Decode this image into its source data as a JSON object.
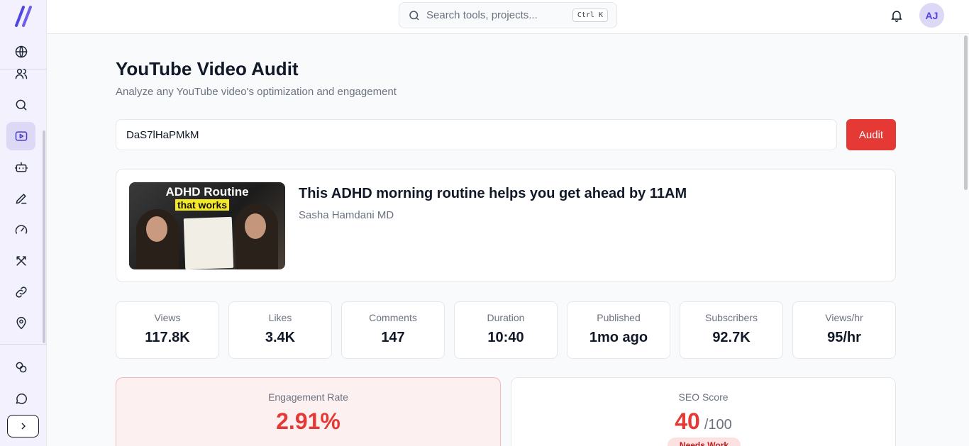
{
  "search": {
    "placeholder": "Search tools, projects...",
    "shortcut": "Ctrl K"
  },
  "user": {
    "initials": "AJ"
  },
  "page": {
    "title": "YouTube Video Audit",
    "subtitle": "Analyze any YouTube video's optimization and engagement"
  },
  "audit": {
    "video_id": "DaS7lHaPMkM",
    "button_label": "Audit"
  },
  "video": {
    "thumbnail_title": "ADHD Routine",
    "thumbnail_highlight": "that works",
    "title": "This ADHD morning routine helps you get ahead by 11AM",
    "channel": "Sasha Hamdani MD"
  },
  "stats": [
    {
      "label": "Views",
      "value": "117.8K"
    },
    {
      "label": "Likes",
      "value": "3.4K"
    },
    {
      "label": "Comments",
      "value": "147"
    },
    {
      "label": "Duration",
      "value": "10:40"
    },
    {
      "label": "Published",
      "value": "1mo ago"
    },
    {
      "label": "Subscribers",
      "value": "92.7K"
    },
    {
      "label": "Views/hr",
      "value": "95/hr"
    }
  ],
  "engagement": {
    "label": "Engagement Rate",
    "value": "2.91%"
  },
  "seo": {
    "label": "SEO Score",
    "value": "40",
    "max": "/100",
    "status": "Needs Work"
  },
  "colors": {
    "accent": "#e53935",
    "brand": "#4f46e5",
    "sidebar_bg": "#f3f1fd"
  }
}
